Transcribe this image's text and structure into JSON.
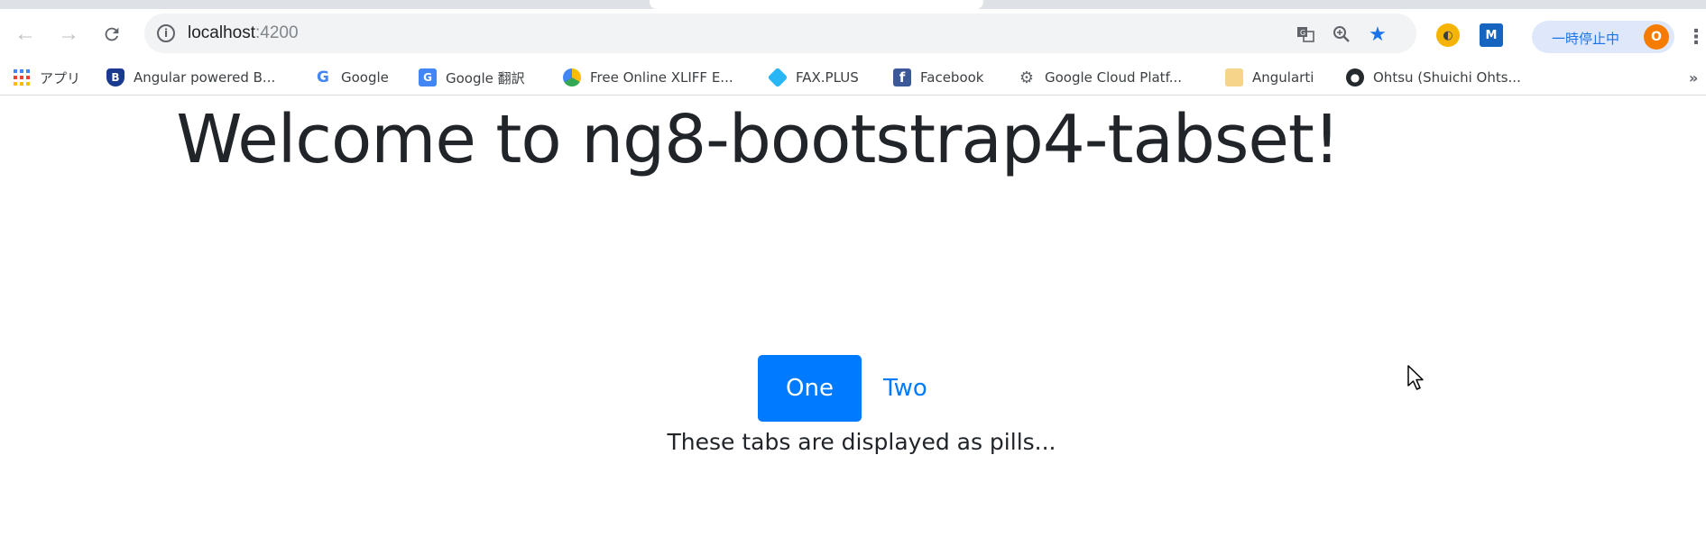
{
  "browser": {
    "url_host": "localhost",
    "url_port": ":4200",
    "paused_label": "一時停止中",
    "profile_initial": "O",
    "extension_m_label": "M"
  },
  "bookmarks": [
    {
      "label": "アプリ",
      "icon": "apps-grid-icon"
    },
    {
      "label": "Angular powered B...",
      "icon": "shield-icon"
    },
    {
      "label": "Google",
      "icon": "google-g-icon"
    },
    {
      "label": "Google 翻訳",
      "icon": "translate-icon"
    },
    {
      "label": "Free Online XLIFF E...",
      "icon": "globe-icon"
    },
    {
      "label": "FAX.PLUS",
      "icon": "fax-icon"
    },
    {
      "label": "Facebook",
      "icon": "facebook-icon"
    },
    {
      "label": "Google Cloud Platf...",
      "icon": "gear-icon"
    },
    {
      "label": "Angularti",
      "icon": "folder-icon"
    },
    {
      "label": "Ohtsu (Shuichi Ohts...",
      "icon": "github-icon"
    }
  ],
  "page": {
    "title": "Welcome to ng8-bootstrap4-tabset!",
    "tabs": [
      {
        "label": "One",
        "active": true
      },
      {
        "label": "Two",
        "active": false
      }
    ],
    "tab_content": "These tabs are displayed as pills..."
  },
  "colors": {
    "primary": "#007bff",
    "text": "#212529",
    "chrome_bg": "#f1f3f4"
  }
}
